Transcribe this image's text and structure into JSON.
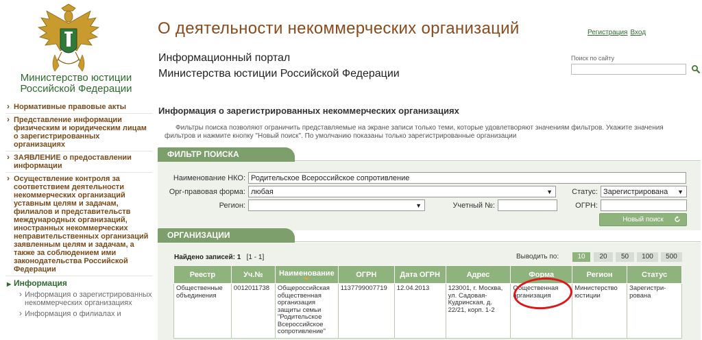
{
  "ministry": {
    "name_line1": "Министерство юстиции",
    "name_line2": "Российской Федерации"
  },
  "header": {
    "site_title": "О деятельности некоммерческих организаций",
    "register_link": "Регистрация",
    "login_link": "Вход",
    "portal_line1": "Информационный портал",
    "portal_line2": "Министерства юстиции Российской Федерации",
    "search_label": "Поиск по сайту",
    "search_value": ""
  },
  "leftnav": {
    "items": [
      "Нормативные правовые акты",
      "Представление информации физическим и юридическим лицам о зарегистрированных организациях",
      "ЗАЯВЛЕНИЕ о предоставлении информации",
      "Осуществление контроля за соответствием деятельности некоммерческих организаций уставным целям и задачам, филиалов и представительств международных организаций, иностранных некоммерческих неправительственных организаций заявленным целям и задачам, а также за соблюдением ими законодательства Российской Федерации"
    ],
    "active": "Информация",
    "subitems": [
      "Информация о зарегистрированных некоммерческих организациях",
      "Информация о филиалах и"
    ]
  },
  "main": {
    "heading": "Информация о зарегистрированных некоммерческих организациях",
    "description": "Фильтры поиска позволяют ограничить представляемые на экране записи только теми, которые удовлетворяют значениям фильтров. Укажите значения фильтров и нажмите кнопку \"Новый поиск\". По умолчанию показаны только зарегистрированные организации"
  },
  "filter": {
    "section_title": "ФИЛЬТР ПОИСКА",
    "nko_label": "Наименование НКО:",
    "nko_value": "Родительское Всероссийское сопротивление",
    "org_form_label": "Орг-правовая форма:",
    "org_form_value": "любая",
    "status_label": "Статус:",
    "status_value": "Зарегистрирована",
    "region_label": "Регион:",
    "region_value": "",
    "reg_no_label": "Учетный №:",
    "reg_no_value": "",
    "ogrn_label": "ОГРН:",
    "ogrn_value": "",
    "new_search_button": "Новый поиск"
  },
  "orgs": {
    "section_title": "ОРГАНИЗАЦИИ",
    "found_label": "Найдено записей:",
    "found_count": "1",
    "range": "[1 - 1]",
    "per_page_label": "Выводить по:",
    "per_page_options": [
      "10",
      "20",
      "50",
      "100",
      "500"
    ],
    "per_page_selected": "10",
    "columns": [
      "Реестр",
      "Уч.№",
      "Наименование",
      "ОГРН",
      "Дата ОГРН",
      "Адрес",
      "Форма",
      "Регион",
      "Статус"
    ],
    "rows": [
      [
        "Общественные объединения",
        "0012011738",
        "Общероссийская общественная организация защиты семьи \"Родительское Всероссийское сопротивление\"",
        "1137799007719",
        "12.04.2013",
        "123001, г. Москва, ул. Садовая-Кудринская, д. 22/21, корп. 1-2",
        "Общественная организация",
        "Министерство юстиции",
        "Зарегистри-рована"
      ]
    ]
  },
  "colors": {
    "brown": "#8a4a1a",
    "green": "#2d6b2d",
    "tab_green": "#7c9f6c",
    "header_green": "#8fb37d",
    "highlight_red": "#e0151a"
  }
}
